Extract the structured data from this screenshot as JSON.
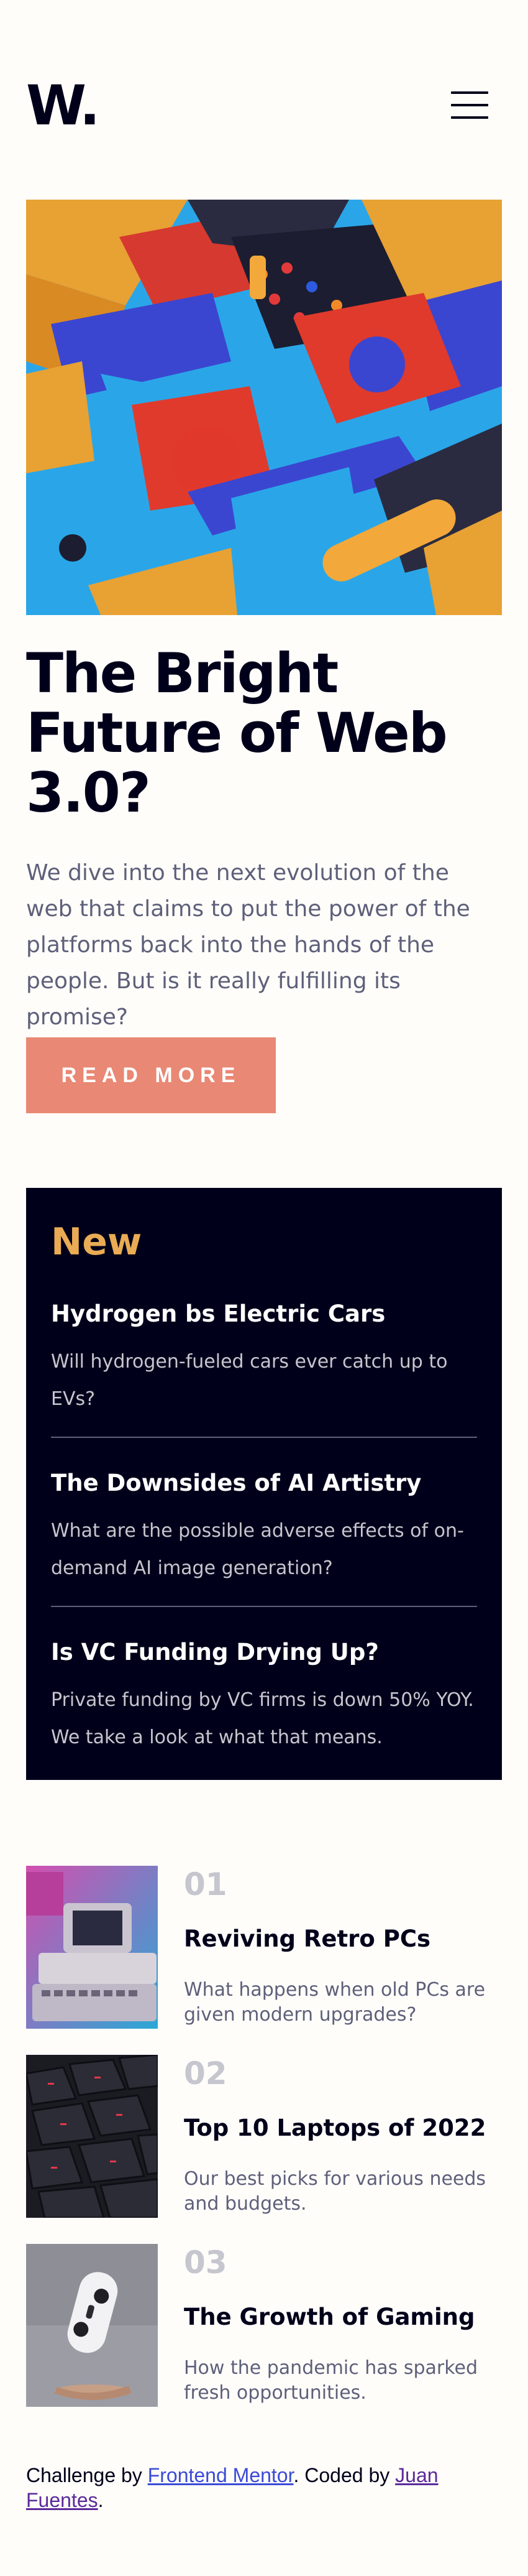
{
  "header": {
    "logo": "W.",
    "menu_icon": "hamburger-menu-icon"
  },
  "hero": {
    "image_alt": "colorful abstract 3D blocks",
    "title": "The Bright Future of Web 3.0?",
    "description": "We dive into the next evolution of the web that claims to put the power of the platforms back into the hands of the people. But is it really fulfilling its promise?",
    "button_label": "READ MORE"
  },
  "new": {
    "title": "New",
    "items": [
      {
        "title": "Hydrogen bs Electric Cars",
        "description": "Will hydrogen-fueled cars ever catch up to EVs?"
      },
      {
        "title": "The Downsides of AI Artistry",
        "description": "What are the possible adverse effects of on-demand AI image generation?"
      },
      {
        "title": "Is VC Funding Drying Up?",
        "description": "Private funding by VC firms is down 50% YOY. We take a look at what that means."
      }
    ]
  },
  "articles": [
    {
      "number": "01",
      "title": "Reviving Retro PCs",
      "description": "What happens when old PCs are given modern upgrades?"
    },
    {
      "number": "02",
      "title": "Top 10 Laptops of 2022",
      "description": "Our best picks for various needs and budgets."
    },
    {
      "number": "03",
      "title": "The Growth of Gaming",
      "description": "How the pandemic has sparked fresh opportunities."
    }
  ],
  "footer": {
    "prefix": "Challenge by ",
    "link1": "Frontend Mentor",
    "middle": ". Coded by ",
    "link2": "Juan Fuentes",
    "suffix": "."
  },
  "colors": {
    "accent_red": "#e98874",
    "accent_orange": "#e9ab53",
    "dark_navy": "#00001a",
    "grayish_blue": "#5e607a",
    "light_gray": "#c5c6ce",
    "off_white": "#fffdfa"
  }
}
